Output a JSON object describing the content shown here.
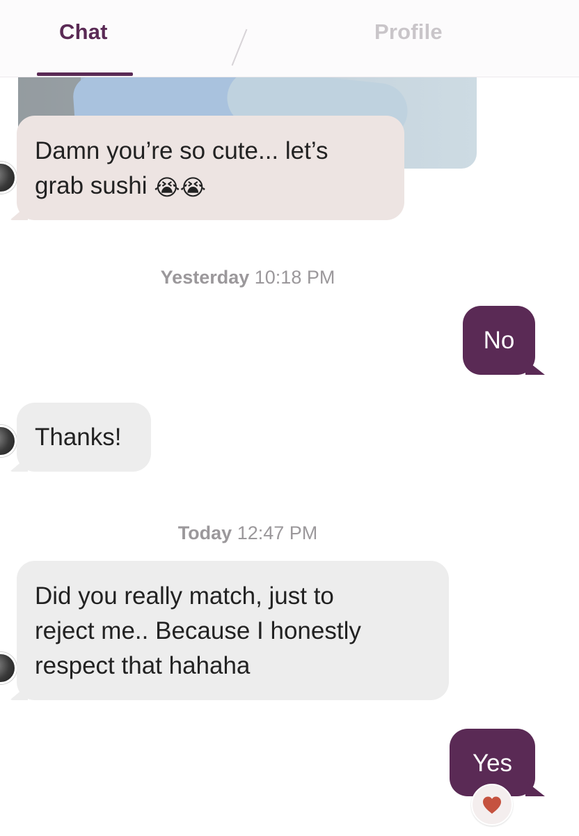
{
  "header": {
    "tabs": [
      {
        "label": "Chat",
        "active": true
      },
      {
        "label": "Profile",
        "active": false
      }
    ]
  },
  "colors": {
    "accent": "#5a2a55",
    "incoming_bubble": "#ededed",
    "incoming_bubble_tint": "#ede4e2",
    "timestamp": "#9b989b",
    "heart": "#c5523f"
  },
  "messages": [
    {
      "id": "m1",
      "direction": "incoming",
      "text": "Damn you’re so cute... let’s",
      "text_line2": "grab sushi",
      "emoji": "😭😭"
    },
    {
      "id": "m2",
      "direction": "outgoing",
      "text": "No"
    },
    {
      "id": "m3",
      "direction": "incoming",
      "text": "Thanks!"
    },
    {
      "id": "m4",
      "direction": "incoming",
      "lines": [
        "Did you really match, just to",
        "reject me.. Because I honestly",
        "respect that hahaha"
      ]
    },
    {
      "id": "m5",
      "direction": "outgoing",
      "text": "Yes",
      "reaction": "heart-icon"
    }
  ],
  "timestamps": [
    {
      "day": "Yesterday",
      "time": "10:18 PM"
    },
    {
      "day": "Today",
      "time": "12:47 PM"
    }
  ]
}
